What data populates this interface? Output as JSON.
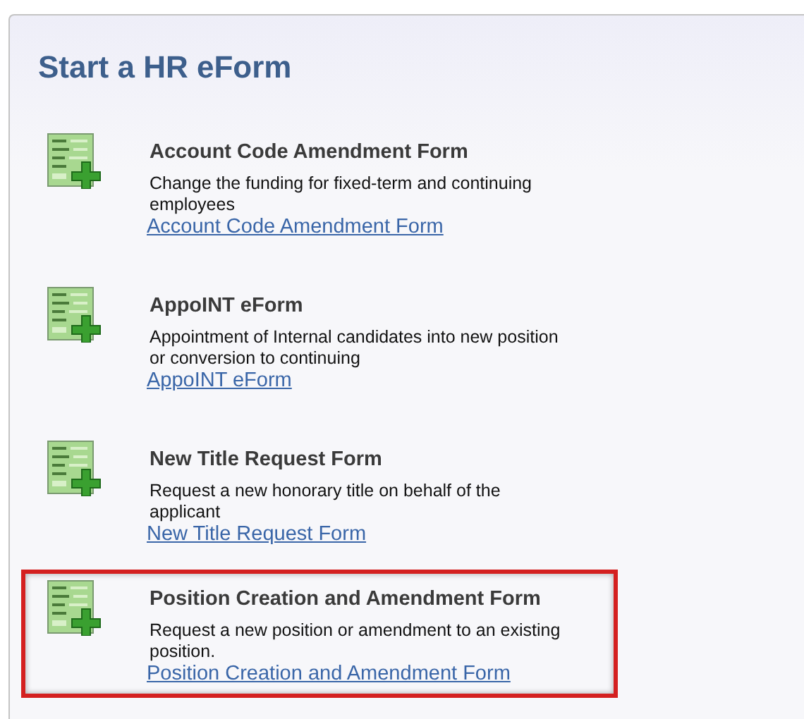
{
  "title": "Start a HR eForm",
  "forms": [
    {
      "name": "Account Code Amendment Form",
      "description": "Change the funding for fixed-term and continuing employees",
      "link": "Account Code Amendment Form",
      "highlighted": false
    },
    {
      "name": "AppoINT eForm",
      "description": "Appointment of Internal candidates into new position or conversion to continuing",
      "link": "AppoINT eForm",
      "highlighted": false
    },
    {
      "name": "New Title Request Form",
      "description": "Request a new honorary title on behalf of the applicant",
      "link": "New Title Request Form",
      "highlighted": false
    },
    {
      "name": "Position Creation and Amendment Form",
      "description": "Request a new position or amendment to an existing position.",
      "link": "Position Creation and Amendment Form",
      "highlighted": true
    }
  ]
}
